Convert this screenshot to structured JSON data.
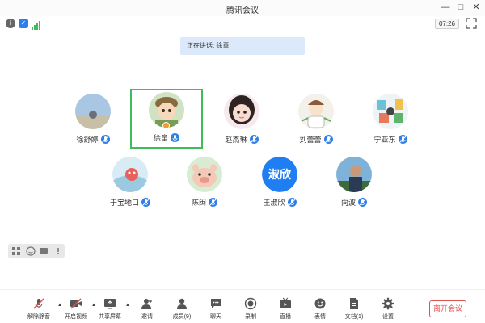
{
  "window": {
    "title": "腾讯会议"
  },
  "status": {
    "time": "07:26"
  },
  "speaker_banner": "正在讲话: 徐童;",
  "participants": [
    {
      "name": "徐舒婷"
    },
    {
      "name": "徐童"
    },
    {
      "name": "赵杰琳"
    },
    {
      "name": "刘蕾蕾"
    },
    {
      "name": "宁亚东"
    },
    {
      "name": "于宝地口"
    },
    {
      "name": "陈闽"
    },
    {
      "name": "王淑欣",
      "avatar_text": "淑欣"
    },
    {
      "name": "向波"
    }
  ],
  "toolbar": {
    "unmute": "解除静音",
    "video": "开启视频",
    "share": "共享屏幕",
    "invite": "邀请",
    "members": "成员(9)",
    "chat": "聊天",
    "record": "录制",
    "live": "直播",
    "reactions": "表情",
    "docs": "文档(1)",
    "settings": "设置",
    "leave": "离开会议"
  },
  "colors": {
    "accent": "#2f7fe9",
    "active_border": "#3fbd5c",
    "leave": "#e05151",
    "mute_red": "#e05151"
  }
}
